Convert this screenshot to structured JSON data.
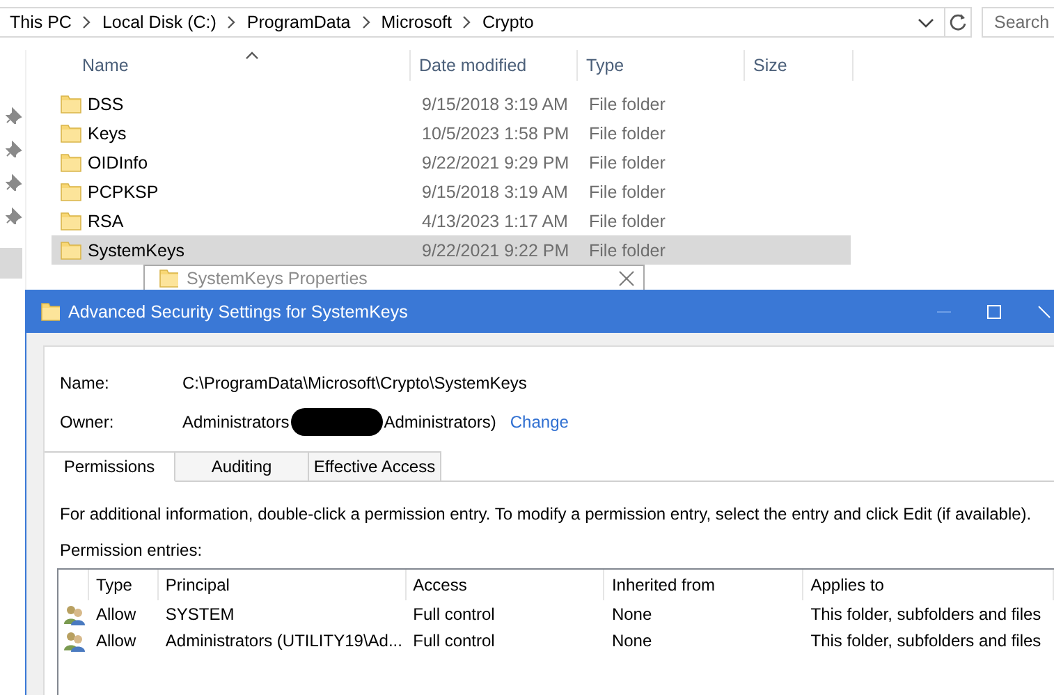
{
  "explorer": {
    "breadcrumbs": [
      "This PC",
      "Local Disk (C:)",
      "ProgramData",
      "Microsoft",
      "Crypto"
    ],
    "search": {
      "placeholder": "Search"
    },
    "columns": [
      "Name",
      "Date modified",
      "Type",
      "Size"
    ],
    "rows": [
      {
        "name": "DSS",
        "date": "9/15/2018 3:19 AM",
        "type": "File folder",
        "selected": false
      },
      {
        "name": "Keys",
        "date": "10/5/2023 1:58 PM",
        "type": "File folder",
        "selected": false
      },
      {
        "name": "OIDInfo",
        "date": "9/22/2021 9:29 PM",
        "type": "File folder",
        "selected": false
      },
      {
        "name": "PCPKSP",
        "date": "9/15/2018 3:19 AM",
        "type": "File folder",
        "selected": false
      },
      {
        "name": "RSA",
        "date": "4/13/2023 1:17 AM",
        "type": "File folder",
        "selected": false
      },
      {
        "name": "SystemKeys",
        "date": "9/22/2021 9:22 PM",
        "type": "File folder",
        "selected": true
      }
    ]
  },
  "properties_window": {
    "title": "SystemKeys Properties"
  },
  "security_window": {
    "title": "Advanced Security Settings for SystemKeys",
    "name_label": "Name:",
    "name_value": "C:\\ProgramData\\Microsoft\\Crypto\\SystemKeys",
    "owner_label": "Owner:",
    "owner_prefix": "Administrators",
    "owner_suffix": "Administrators)",
    "change_link": "Change",
    "tabs": [
      {
        "label": "Permissions",
        "selected": true
      },
      {
        "label": "Auditing",
        "selected": false
      },
      {
        "label": "Effective Access",
        "selected": false
      }
    ],
    "info": "For additional information, double-click a permission entry. To modify a permission entry, select the entry and click Edit (if available).",
    "entries_label": "Permission entries:",
    "columns": [
      "Type",
      "Principal",
      "Access",
      "Inherited from",
      "Applies to"
    ],
    "rows": [
      {
        "type": "Allow",
        "principal": "SYSTEM",
        "access": "Full control",
        "inherited_from": "None",
        "applies_to": "This folder, subfolders and files"
      },
      {
        "type": "Allow",
        "principal": "Administrators (UTILITY19\\Ad...",
        "access": "Full control",
        "inherited_from": "None",
        "applies_to": "This folder, subfolders and files"
      }
    ]
  }
}
